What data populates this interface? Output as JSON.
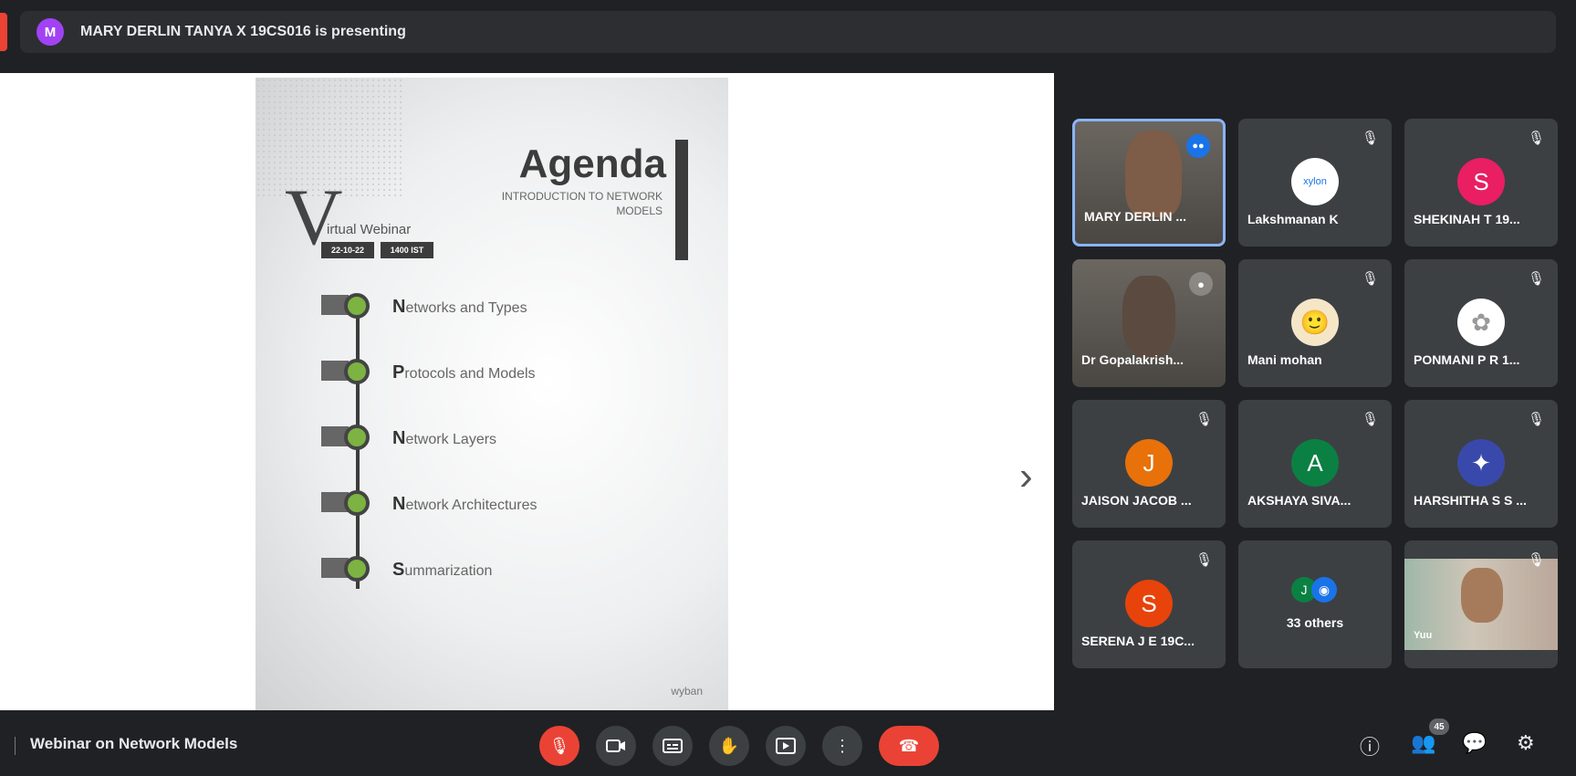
{
  "presenter_bar": {
    "initial": "M",
    "text": "MARY DERLIN TANYA X 19CS016 is presenting"
  },
  "slide": {
    "title": "Agenda",
    "subtitle": "INTRODUCTION TO NETWORK MODELS",
    "v_letter": "V",
    "virtual": "irtual Webinar",
    "date_chip": "22-10-22",
    "time_chip": "1400 IST",
    "items": [
      {
        "first": "N",
        "rest": "etworks and Types",
        "tag": "",
        "sub": ""
      },
      {
        "first": "P",
        "rest": "rotocols and Models",
        "tag": "",
        "sub": ""
      },
      {
        "first": "N",
        "rest": "etwork Layers",
        "tag": "",
        "sub": ""
      },
      {
        "first": "N",
        "rest": "etwork Architectures",
        "tag": "",
        "sub": ""
      },
      {
        "first": "S",
        "rest": "ummarization",
        "tag": "",
        "sub": ""
      }
    ],
    "footer": "",
    "logo": "wyban"
  },
  "icons": {
    "next_arrow": "›",
    "resize": "⤡",
    "mic_off": "🎙",
    "raise_hand": "✋",
    "more": "⋮",
    "end_call": "☎",
    "info": "ⓘ",
    "people": "👥",
    "chat": "💬",
    "activities": "⚙"
  },
  "participants": [
    {
      "name": "MARY DERLIN ...",
      "type": "video",
      "highlight": true,
      "badge": "●●"
    },
    {
      "name": "Lakshmanan K",
      "initial": "xylon",
      "color": "#ffffff",
      "text_color": "#1a73e8"
    },
    {
      "name": "SHEKINAH T 19...",
      "initial": "S",
      "color": "#e91e63"
    },
    {
      "name": "Dr Gopalakrish...",
      "type": "video2",
      "badge": "●"
    },
    {
      "name": "Mani mohan",
      "initial": "🙂",
      "color": "#f5e6c8"
    },
    {
      "name": "PONMANI P R 1...",
      "initial": "✿",
      "color": "#ffffff",
      "text_color": "#999999"
    },
    {
      "name": "JAISON JACOB ...",
      "initial": "J",
      "color": "#e8710a"
    },
    {
      "name": "AKSHAYA SIVA...",
      "initial": "A",
      "color": "#0b8043"
    },
    {
      "name": "HARSHITHA S S ...",
      "initial": "✦",
      "color": "#3949ab"
    },
    {
      "name": "SERENA J E 19C...",
      "initial": "S",
      "color": "#e8430a"
    },
    {
      "name": "33 others",
      "type": "others",
      "initials": [
        "J",
        "◉"
      ]
    },
    {
      "name": "Yuu",
      "type": "photo"
    }
  ],
  "bottom": {
    "meeting_name": "Webinar on Network Models",
    "people_count": "45"
  },
  "colors": {
    "red": "#ea4335",
    "bar": "#2d2e31",
    "tile": "#3c4043",
    "accent": "#8ab4f8"
  }
}
